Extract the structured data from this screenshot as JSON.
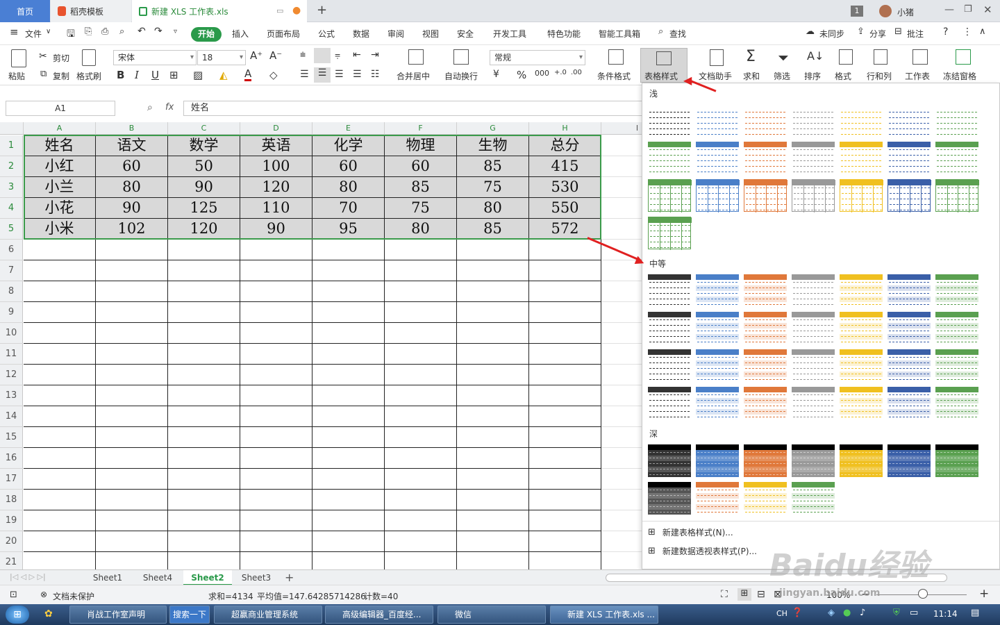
{
  "tabs": {
    "home": "首页",
    "template": "稻壳模板",
    "doc": "新建 XLS 工作表.xls",
    "user": "小猪",
    "badge": "1"
  },
  "menu": {
    "file": "文件",
    "items": [
      "开始",
      "插入",
      "页面布局",
      "公式",
      "数据",
      "审阅",
      "视图",
      "安全",
      "开发工具",
      "特色功能",
      "智能工具箱"
    ],
    "search": "查找",
    "sync": "未同步",
    "share": "分享",
    "comment": "批注"
  },
  "ribbon": {
    "paste": "粘贴",
    "cut": "剪切",
    "copy": "复制",
    "format_painter": "格式刷",
    "font": "宋体",
    "size": "18",
    "number_format": "常规",
    "merge": "合并居中",
    "wrap": "自动换行",
    "cond_format": "条件格式",
    "table_style": "表格样式",
    "doc_helper": "文档助手",
    "sum": "求和",
    "filter": "筛选",
    "sort": "排序",
    "format": "格式",
    "rowcol": "行和列",
    "worksheet": "工作表",
    "freeze": "冻结窗格"
  },
  "formula": {
    "cell": "A1",
    "fx": "fx",
    "value": "姓名"
  },
  "columns": [
    "A",
    "B",
    "C",
    "D",
    "E",
    "F",
    "G",
    "H",
    "I"
  ],
  "rows": [
    "1",
    "2",
    "3",
    "4",
    "5",
    "6",
    "7",
    "8",
    "9",
    "10",
    "11",
    "12",
    "13",
    "14",
    "15",
    "16",
    "17",
    "18",
    "19",
    "20",
    "21"
  ],
  "table": [
    [
      "姓名",
      "语文",
      "数学",
      "英语",
      "化学",
      "物理",
      "生物",
      "总分"
    ],
    [
      "小红",
      "60",
      "50",
      "100",
      "60",
      "60",
      "85",
      "415"
    ],
    [
      "小兰",
      "80",
      "90",
      "120",
      "80",
      "85",
      "75",
      "530"
    ],
    [
      "小花",
      "90",
      "125",
      "110",
      "70",
      "75",
      "80",
      "550"
    ],
    [
      "小米",
      "102",
      "120",
      "90",
      "95",
      "80",
      "85",
      "572"
    ]
  ],
  "panel": {
    "light": "浅",
    "medium": "中等",
    "dark": "深",
    "new_table_style": "新建表格样式(N)...",
    "new_pivot_style": "新建数据透视表样式(P)..."
  },
  "sheets": [
    "Sheet1",
    "Sheet4",
    "Sheet2",
    "Sheet3"
  ],
  "active_sheet": "Sheet2",
  "status": {
    "protect": "文档未保护",
    "sum": "求和=4134",
    "avg": "平均值=147.64285714286",
    "count": "计数=40",
    "zoom": "100%"
  },
  "taskbar": {
    "items": [
      "肖战工作室声明",
      "搜索一下",
      "超赢商业管理系统",
      "高级编辑器_百度经...",
      "微信",
      "新建 XLS 工作表.xls ..."
    ],
    "lang": "CH",
    "time": "11:14"
  },
  "watermark": {
    "brand": "Baidu经验",
    "url": "jingyan.baidu.com"
  },
  "colors": {
    "accent": "#2a9a4a",
    "selection": "#3a9a4a",
    "arrow": "#e02020"
  }
}
